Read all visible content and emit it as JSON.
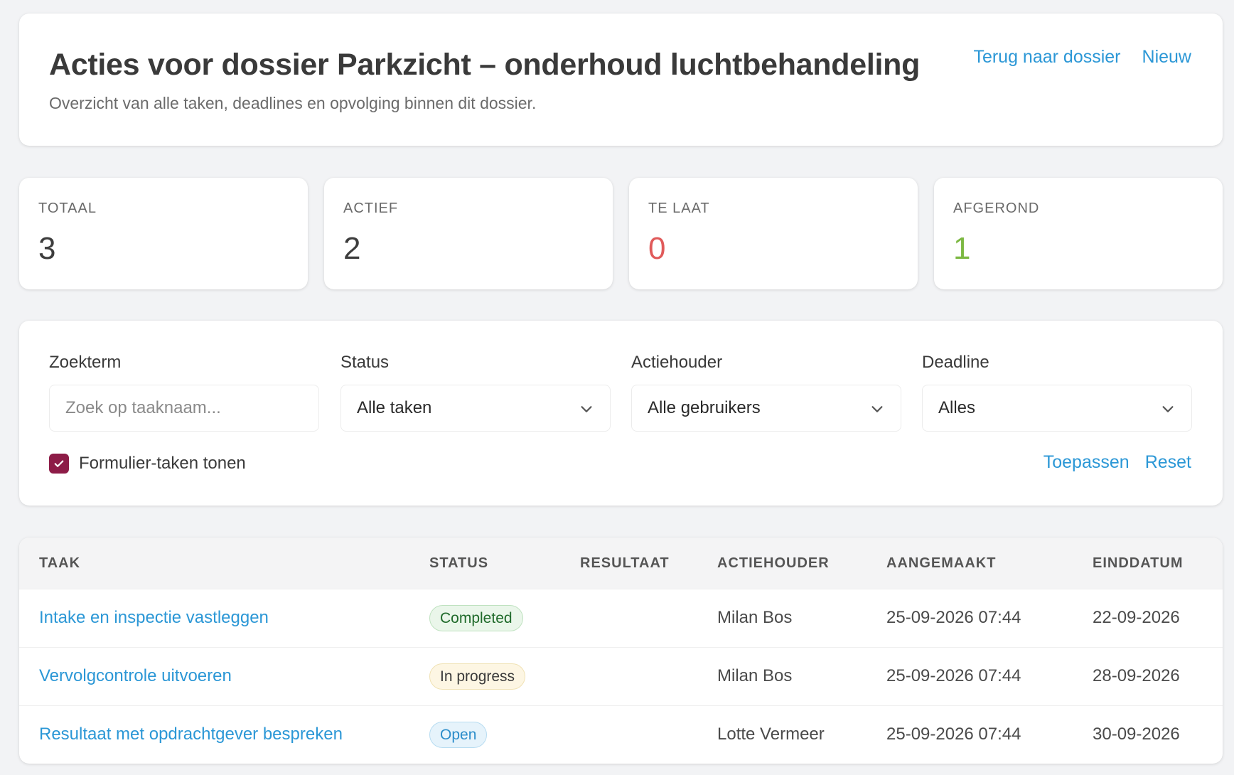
{
  "header": {
    "title": "Acties voor dossier Parkzicht – onderhoud luchtbehandeling",
    "subtitle": "Overzicht van alle taken, deadlines en opvolging binnen dit dossier.",
    "back_link": "Terug naar dossier",
    "new_link": "Nieuw"
  },
  "stats": [
    {
      "label": "TOTAAL",
      "value": "3",
      "color": "#3d3d3d"
    },
    {
      "label": "ACTIEF",
      "value": "2",
      "color": "#3d3d3d"
    },
    {
      "label": "TE LAAT",
      "value": "0",
      "color": "#e05a5a"
    },
    {
      "label": "AFGEROND",
      "value": "1",
      "color": "#7cb842"
    }
  ],
  "filters": {
    "search": {
      "label": "Zoekterm",
      "placeholder": "Zoek op taaknaam...",
      "value": ""
    },
    "status": {
      "label": "Status",
      "value": "Alle taken"
    },
    "owner": {
      "label": "Actiehouder",
      "value": "Alle gebruikers"
    },
    "deadline": {
      "label": "Deadline",
      "value": "Alles"
    },
    "show_form_tasks": {
      "label": "Formulier-taken tonen",
      "checked": true
    },
    "apply_label": "Toepassen",
    "reset_label": "Reset"
  },
  "table": {
    "columns": [
      "TAAK",
      "STATUS",
      "RESULTAAT",
      "ACTIEHOUDER",
      "AANGEMAAKT",
      "EINDDATUM"
    ],
    "rows": [
      {
        "task": "Intake en inspectie vastleggen",
        "status": "Completed",
        "status_kind": "completed",
        "result": "",
        "owner": "Milan Bos",
        "created": "25-09-2026 07:44",
        "due": "22-09-2026"
      },
      {
        "task": "Vervolgcontrole uitvoeren",
        "status": "In progress",
        "status_kind": "progress",
        "result": "",
        "owner": "Milan Bos",
        "created": "25-09-2026 07:44",
        "due": "28-09-2026"
      },
      {
        "task": "Resultaat met opdrachtgever bespreken",
        "status": "Open",
        "status_kind": "open",
        "result": "",
        "owner": "Lotte Vermeer",
        "created": "25-09-2026 07:44",
        "due": "30-09-2026"
      }
    ]
  },
  "colors": {
    "accent": "#2b97d6",
    "checkbox": "#8d1c47"
  }
}
